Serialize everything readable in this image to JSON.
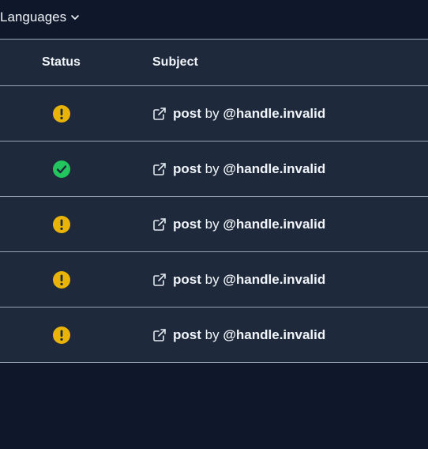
{
  "toolbar": {
    "languages_label": "Languages"
  },
  "table": {
    "headers": {
      "status": "Status",
      "subject": "Subject"
    },
    "rows": [
      {
        "status": "warning",
        "subject_type": "post",
        "by_word": "by",
        "handle": "@handle.invalid"
      },
      {
        "status": "success",
        "subject_type": "post",
        "by_word": "by",
        "handle": "@handle.invalid"
      },
      {
        "status": "warning",
        "subject_type": "post",
        "by_word": "by",
        "handle": "@handle.invalid"
      },
      {
        "status": "warning",
        "subject_type": "post",
        "by_word": "by",
        "handle": "@handle.invalid"
      },
      {
        "status": "warning",
        "subject_type": "post",
        "by_word": "by",
        "handle": "@handle.invalid"
      }
    ]
  },
  "colors": {
    "background": "#0f172a",
    "row_background": "#1e293b",
    "divider": "#94a3b8",
    "warning": "#eab308",
    "success": "#22c55e"
  },
  "icons": {
    "warning": "exclamation-circle-icon",
    "success": "check-circle-icon",
    "link": "external-link-icon",
    "dropdown": "chevron-down-icon"
  }
}
